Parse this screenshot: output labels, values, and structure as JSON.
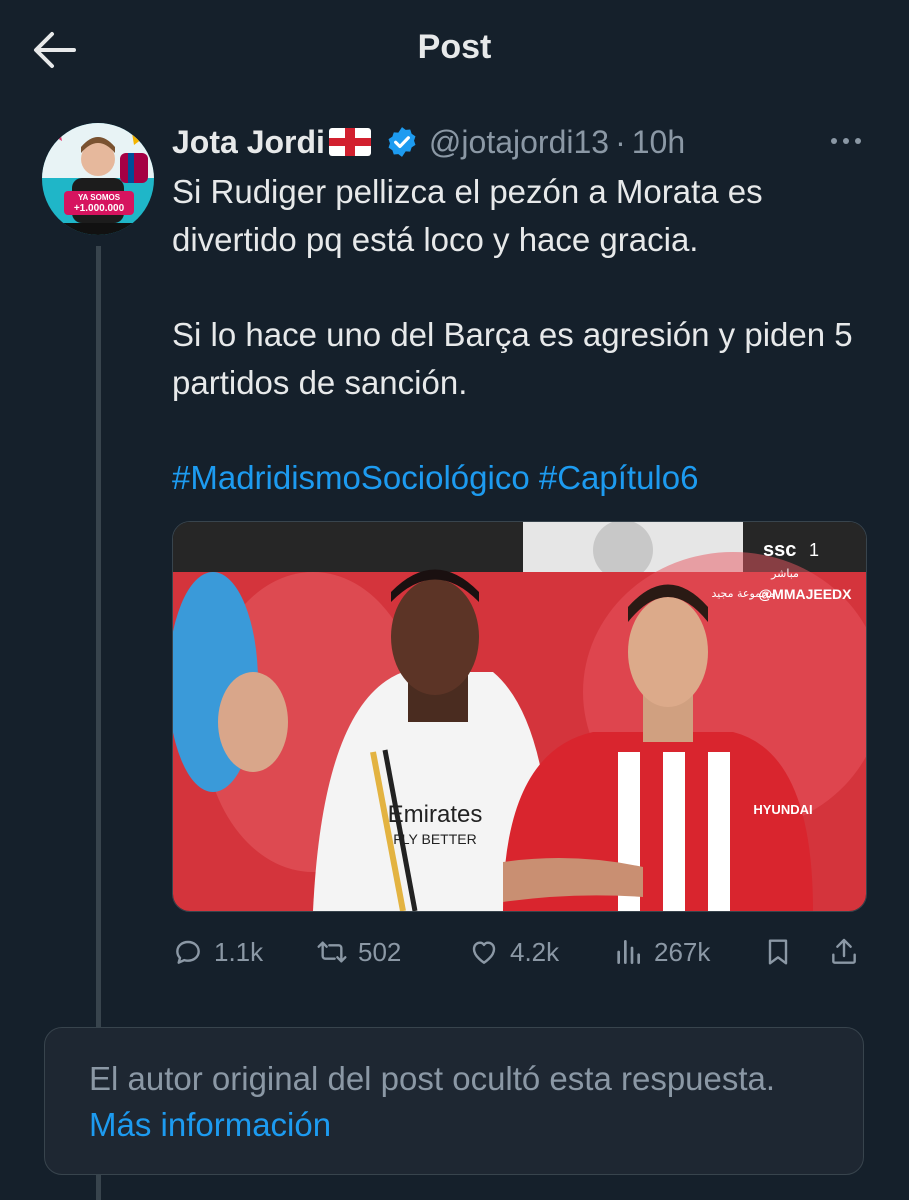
{
  "header": {
    "title": "Post",
    "back_icon": "arrow-left-icon"
  },
  "post": {
    "author_name": "Jota Jordi",
    "author_flag": "england-flag",
    "verified": true,
    "handle": "@jotajordi13",
    "separator": "·",
    "time": "10h",
    "avatar_text": {
      "line1": "YA SOMOS",
      "line2": "+1.000.000"
    },
    "paragraphs": [
      "Si Rudiger pellizca el pezón a Morata es divertido pq está loco y hace gracia.",
      "Si lo hace uno del Barça es agresión y piden 5 partidos de sanción."
    ],
    "hashtags": [
      "#MadridismoSociológico",
      "#Capítulo6"
    ],
    "media": {
      "overlay_brand": "ssc",
      "overlay_channel": "1",
      "overlay_live": "مباشر",
      "overlay_watermark": "@MMAJEEDX",
      "overlay_arabic_logo": "مجموعة مجيد",
      "jersey_text_left": "Emirates",
      "jersey_text_left_2": "FLY BETTER",
      "jersey_text_right": "HYUNDAI"
    },
    "actions": {
      "replies": "1.1k",
      "reposts": "502",
      "likes": "4.2k",
      "views": "267k"
    }
  },
  "hidden_reply": {
    "text": "El autor original del post ocultó esta respuesta.",
    "link": "Más información"
  },
  "colors": {
    "background": "#15202b",
    "text": "#e7e9ea",
    "muted": "#8b98a5",
    "link": "#1d9bf0",
    "border": "#38444d"
  }
}
